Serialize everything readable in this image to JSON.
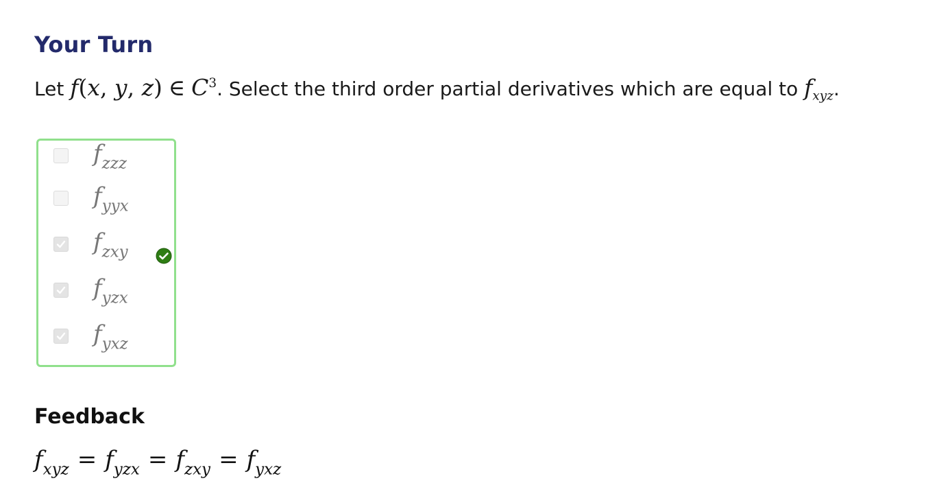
{
  "section": {
    "title": "Your Turn"
  },
  "prompt": {
    "lead": "Let",
    "func_f": "f",
    "func_open": "(",
    "func_x": "x",
    "func_c1": ", ",
    "func_y": "y",
    "func_c2": ", ",
    "func_z": "z",
    "func_close": ")",
    "elem": "∈",
    "cls": "C",
    "cls_sup": "3",
    "middle": ". Select the third order partial derivatives which are equal to",
    "target_f": "f",
    "target_sub": "xyz",
    "end": "."
  },
  "options": [
    {
      "f": "f",
      "sub": "zzz",
      "checked": false
    },
    {
      "f": "f",
      "sub": "yyx",
      "checked": false
    },
    {
      "f": "f",
      "sub": "zxy",
      "checked": true
    },
    {
      "f": "f",
      "sub": "yzx",
      "checked": true
    },
    {
      "f": "f",
      "sub": "yxz",
      "checked": true
    }
  ],
  "colors": {
    "title": "#232a6b",
    "box_border": "#90e08c",
    "correct_icon": "#2e7d14"
  },
  "icons": {
    "correct": "check-circle-icon",
    "checkbox_check": "check-icon"
  },
  "feedback": {
    "title": "Feedback",
    "terms": [
      {
        "f": "f",
        "sub": "xyz"
      },
      {
        "f": "f",
        "sub": "yzx"
      },
      {
        "f": "f",
        "sub": "zxy"
      },
      {
        "f": "f",
        "sub": "yxz"
      }
    ],
    "eq": "="
  }
}
